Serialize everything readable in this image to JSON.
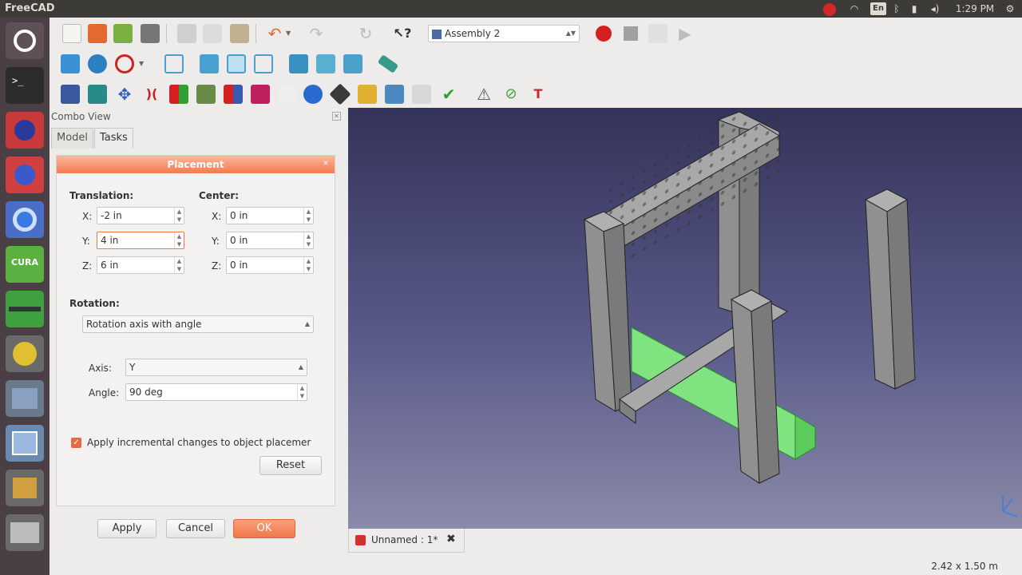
{
  "topbar": {
    "app_title": "FreeCAD",
    "lang": "En",
    "time": "1:29 PM"
  },
  "toolbar": {
    "workbench": "Assembly 2"
  },
  "combo_view": {
    "title": "Combo View",
    "tabs": [
      {
        "label": "Model"
      },
      {
        "label": "Tasks"
      }
    ]
  },
  "placement": {
    "header": "Placement",
    "translation_label": "Translation:",
    "center_label": "Center:",
    "translation": {
      "x_label": "X:",
      "x": "-2 in",
      "y_label": "Y:",
      "y": "4 in",
      "z_label": "Z:",
      "z": "6 in"
    },
    "center": {
      "x_label": "X:",
      "x": "0 in",
      "y_label": "Y:",
      "y": "0 in",
      "z_label": "Z:",
      "z": "0 in"
    },
    "rotation_label": "Rotation:",
    "rotation_mode": "Rotation axis with angle",
    "axis_label": "Axis:",
    "axis": "Y",
    "angle_label": "Angle:",
    "angle": "90 deg",
    "incremental_label": "Apply incremental changes to object placemer",
    "reset_label": "Reset"
  },
  "dialog_buttons": {
    "apply": "Apply",
    "cancel": "Cancel",
    "ok": "OK"
  },
  "document_tab": {
    "label": "Unnamed : 1*"
  },
  "status": {
    "dimensions": "2.42 x 1.50 m"
  },
  "colors": {
    "accent": "#f07746",
    "selected_part": "#88f088",
    "part_gray": "#8c8c8c"
  }
}
